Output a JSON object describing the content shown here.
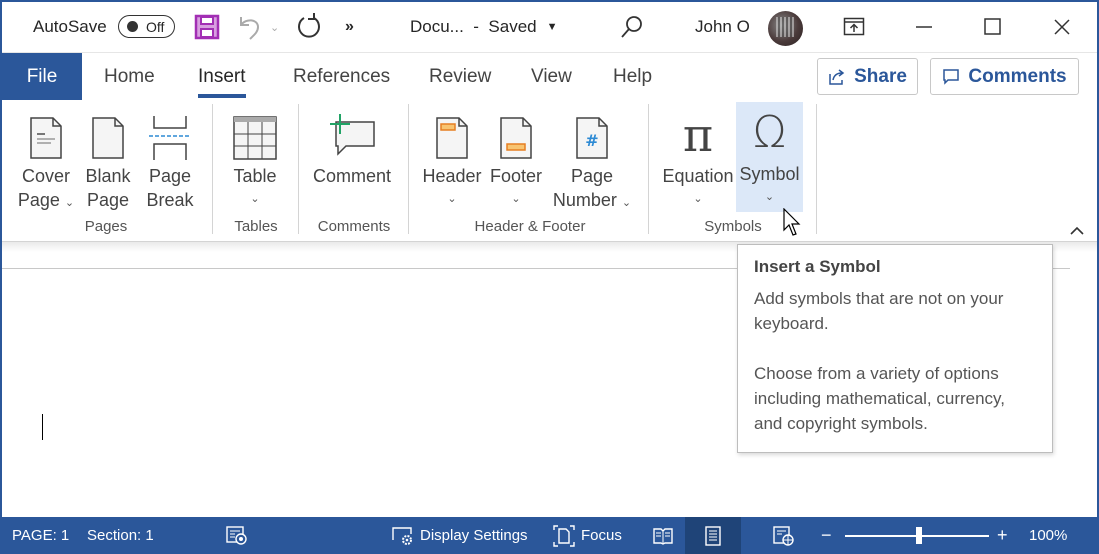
{
  "titlebar": {
    "autosave_label": "AutoSave",
    "autosave_state": "Off",
    "doc_title": "Docu...  -  Saved",
    "user_name": "John O",
    "more_glyph": "»"
  },
  "tabs": [
    {
      "label": "File"
    },
    {
      "label": "Home"
    },
    {
      "label": "Insert",
      "active": true
    },
    {
      "label": "References"
    },
    {
      "label": "Review"
    },
    {
      "label": "View"
    },
    {
      "label": "Help"
    }
  ],
  "header_buttons": {
    "share": "Share",
    "comments": "Comments"
  },
  "ribbon": {
    "buttons": {
      "cover_page": [
        "Cover",
        "Page"
      ],
      "blank_page": [
        "Blank",
        "Page"
      ],
      "page_break": [
        "Page",
        "Break"
      ],
      "table": [
        "Table"
      ],
      "comment": [
        "Comment"
      ],
      "header": [
        "Header"
      ],
      "footer": [
        "Footer"
      ],
      "page_number": [
        "Page",
        "Number"
      ],
      "equation": [
        "Equation"
      ],
      "symbol": [
        "Symbol"
      ]
    },
    "groups": [
      "Pages",
      "Tables",
      "Comments",
      "Header & Footer",
      "Symbols"
    ],
    "icons": {
      "equation": "π",
      "symbol": "Ω",
      "page_number": "#"
    }
  },
  "tooltip": {
    "title": "Insert a Symbol",
    "line1": "Add symbols that are not on your keyboard.",
    "line2": "Choose from a variety of options including mathematical, currency, and copyright symbols."
  },
  "statusbar": {
    "page": "PAGE: 1",
    "section": "Section: 1",
    "display_settings": "Display Settings",
    "focus": "Focus",
    "zoom_minus": "−",
    "zoom_plus": "+",
    "zoom_level": "100%",
    "zoom_fraction": 0.5
  },
  "colors": {
    "accent": "#2b579a",
    "symbol_highlight": "#dce8f8",
    "save_icon": "#b146c2"
  }
}
